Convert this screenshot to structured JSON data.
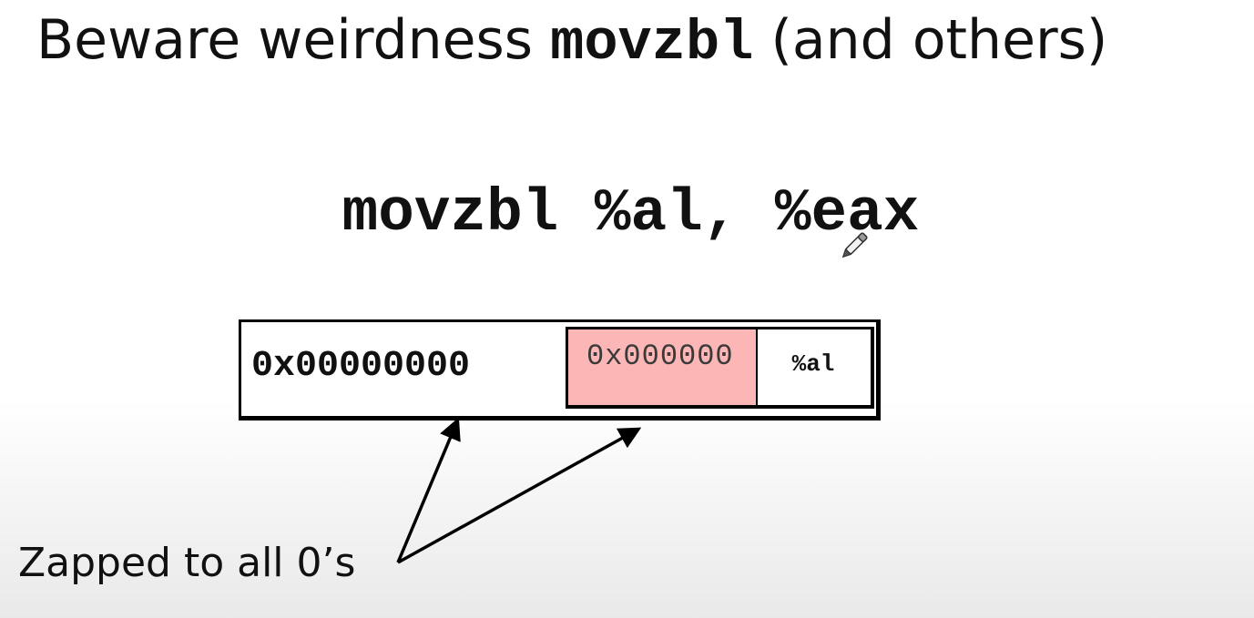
{
  "slide": {
    "title_prefix": "Beware weirdness ",
    "title_code": "movzbl",
    "title_suffix": " (and others)"
  },
  "instruction": {
    "text": "movzbl %al, %eax"
  },
  "register": {
    "upper_value": "0x00000000",
    "ah_value": "0x000000",
    "al_label": "%al",
    "highlight_color": "#fcb6b6"
  },
  "callout": {
    "text": "Zapped to all 0’s"
  },
  "cursor": {
    "icon": "pen-pointer-icon"
  }
}
